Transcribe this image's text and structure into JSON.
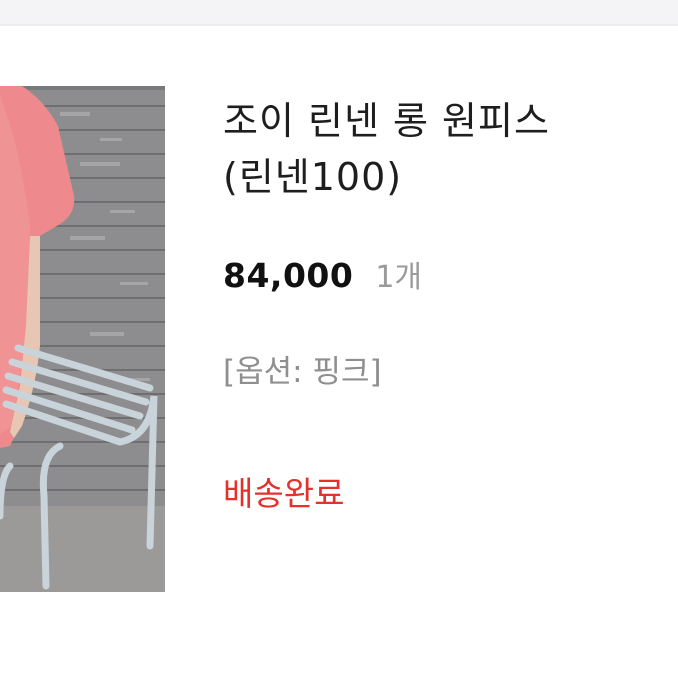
{
  "product": {
    "title_line1": "조이 린넨 롱 원피스",
    "title_line2": "(린넨100)",
    "price": "84,000",
    "quantity": "1개",
    "option": "[옵션: 핑크]",
    "status": "배송완료"
  },
  "colors": {
    "status": "#e4312b",
    "price": "#111111",
    "muted": "#9a9a9a"
  }
}
